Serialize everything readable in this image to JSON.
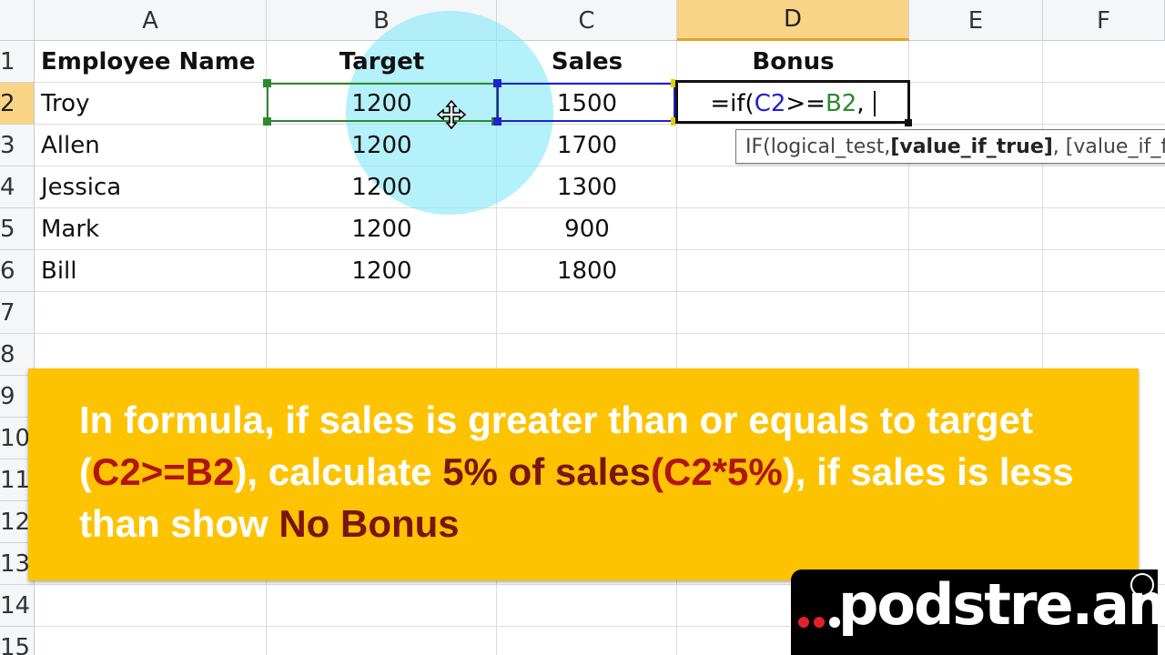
{
  "columns": [
    {
      "id": "A",
      "label": "A"
    },
    {
      "id": "B",
      "label": "B"
    },
    {
      "id": "C",
      "label": "C"
    },
    {
      "id": "D",
      "label": "D"
    },
    {
      "id": "E",
      "label": "E"
    },
    {
      "id": "F",
      "label": "F"
    }
  ],
  "rows": [
    "1",
    "2",
    "3",
    "4",
    "5",
    "6",
    "7",
    "8",
    "9",
    "10",
    "11",
    "12",
    "13",
    "14",
    "15"
  ],
  "headers": {
    "name": "Employee Name",
    "target": "Target",
    "sales": "Sales",
    "bonus": "Bonus"
  },
  "data": [
    {
      "name": "Troy",
      "target": "1200",
      "sales": "1500"
    },
    {
      "name": "Allen",
      "target": "1200",
      "sales": "1700"
    },
    {
      "name": "Jessica",
      "target": "1200",
      "sales": "1300"
    },
    {
      "name": "Mark",
      "target": "1200",
      "sales": "900"
    },
    {
      "name": "Bill",
      "target": "1200",
      "sales": "1800"
    }
  ],
  "edit_cell": {
    "prefix": "=if(",
    "ref1": "C2",
    "op": ">=",
    "ref2": "B2",
    "suffix": ","
  },
  "tooltip": {
    "func": "IF(logical_test, ",
    "current_arg": "[value_if_true]",
    "rest": ", [value_if_false])"
  },
  "banner": {
    "t1": "In formula, if sales is greater than or equals to target (",
    "h1": "C2>=B2",
    "t2": "), calculate ",
    "h2": "5% of sales",
    "h3": "(",
    "h4": "C2*5%",
    "t3": "), if sales is less than show ",
    "h5": "No Bonus"
  },
  "logo": {
    "text": "podstre.am"
  },
  "colors": {
    "accent_header": "#f9d486",
    "banner": "#fdc300",
    "ref_b2": "#2c8a2c",
    "ref_c2": "#2020d0",
    "highlight": "#b01515"
  }
}
